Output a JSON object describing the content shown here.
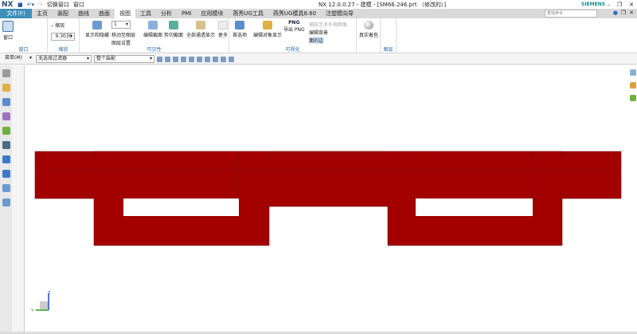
{
  "app": {
    "logo": "NX",
    "title": "NX 12.0.0.27 - 建模 - [SM66.246.prt （修改的）]",
    "brand": "SIEMENS",
    "quick_access": {
      "switch_window": "切换窗口",
      "window": "窗口"
    }
  },
  "tabs": [
    {
      "label": "文件(F)"
    },
    {
      "label": "主页"
    },
    {
      "label": "装配"
    },
    {
      "label": "曲线"
    },
    {
      "label": "曲面"
    },
    {
      "label": "视图",
      "active": true
    },
    {
      "label": "工具"
    },
    {
      "label": "分析"
    },
    {
      "label": "PMI"
    },
    {
      "label": "应用模块"
    },
    {
      "label": "燕秀UG工具"
    },
    {
      "label": "燕秀UG模具8.60"
    },
    {
      "label": "注塑模向导"
    }
  ],
  "search": {
    "placeholder": "查找命令"
  },
  "ribbon": {
    "window_group": {
      "label": "窗口",
      "button": "窗口"
    },
    "zoom_group": {
      "label": "缩放",
      "button": "缩放",
      "value": "9.3030"
    },
    "visible_group": {
      "label": "可见性",
      "show_hide": "显示和隐藏",
      "layer_value": "1",
      "move_to_layer": "移动至图层",
      "layer_settings": "图层设置",
      "edit_section": "编辑截面",
      "clip_section": "剪切截面",
      "show_all": "全部通透显示",
      "more": "更多"
    },
    "visual_group": {
      "label": "可视化",
      "preselect": "首选项",
      "edit_object_display": "编辑对象显示",
      "export_png": "导出 PNG",
      "png_badge": "PNG",
      "artistic": "捕获艺术外观图像",
      "edit_background": "编辑背景",
      "face_edges": "面的边"
    },
    "true_shading": {
      "button": "真实着色"
    },
    "layer_group": {
      "label": "图层"
    }
  },
  "toolbar": {
    "menu": "菜单(M)",
    "filter": "无选择过滤器",
    "scope": "整个装配"
  },
  "triad": {
    "z": "Z",
    "y": "Y"
  },
  "colors": {
    "model": "#a00000",
    "accent": "#3d8eb9"
  }
}
